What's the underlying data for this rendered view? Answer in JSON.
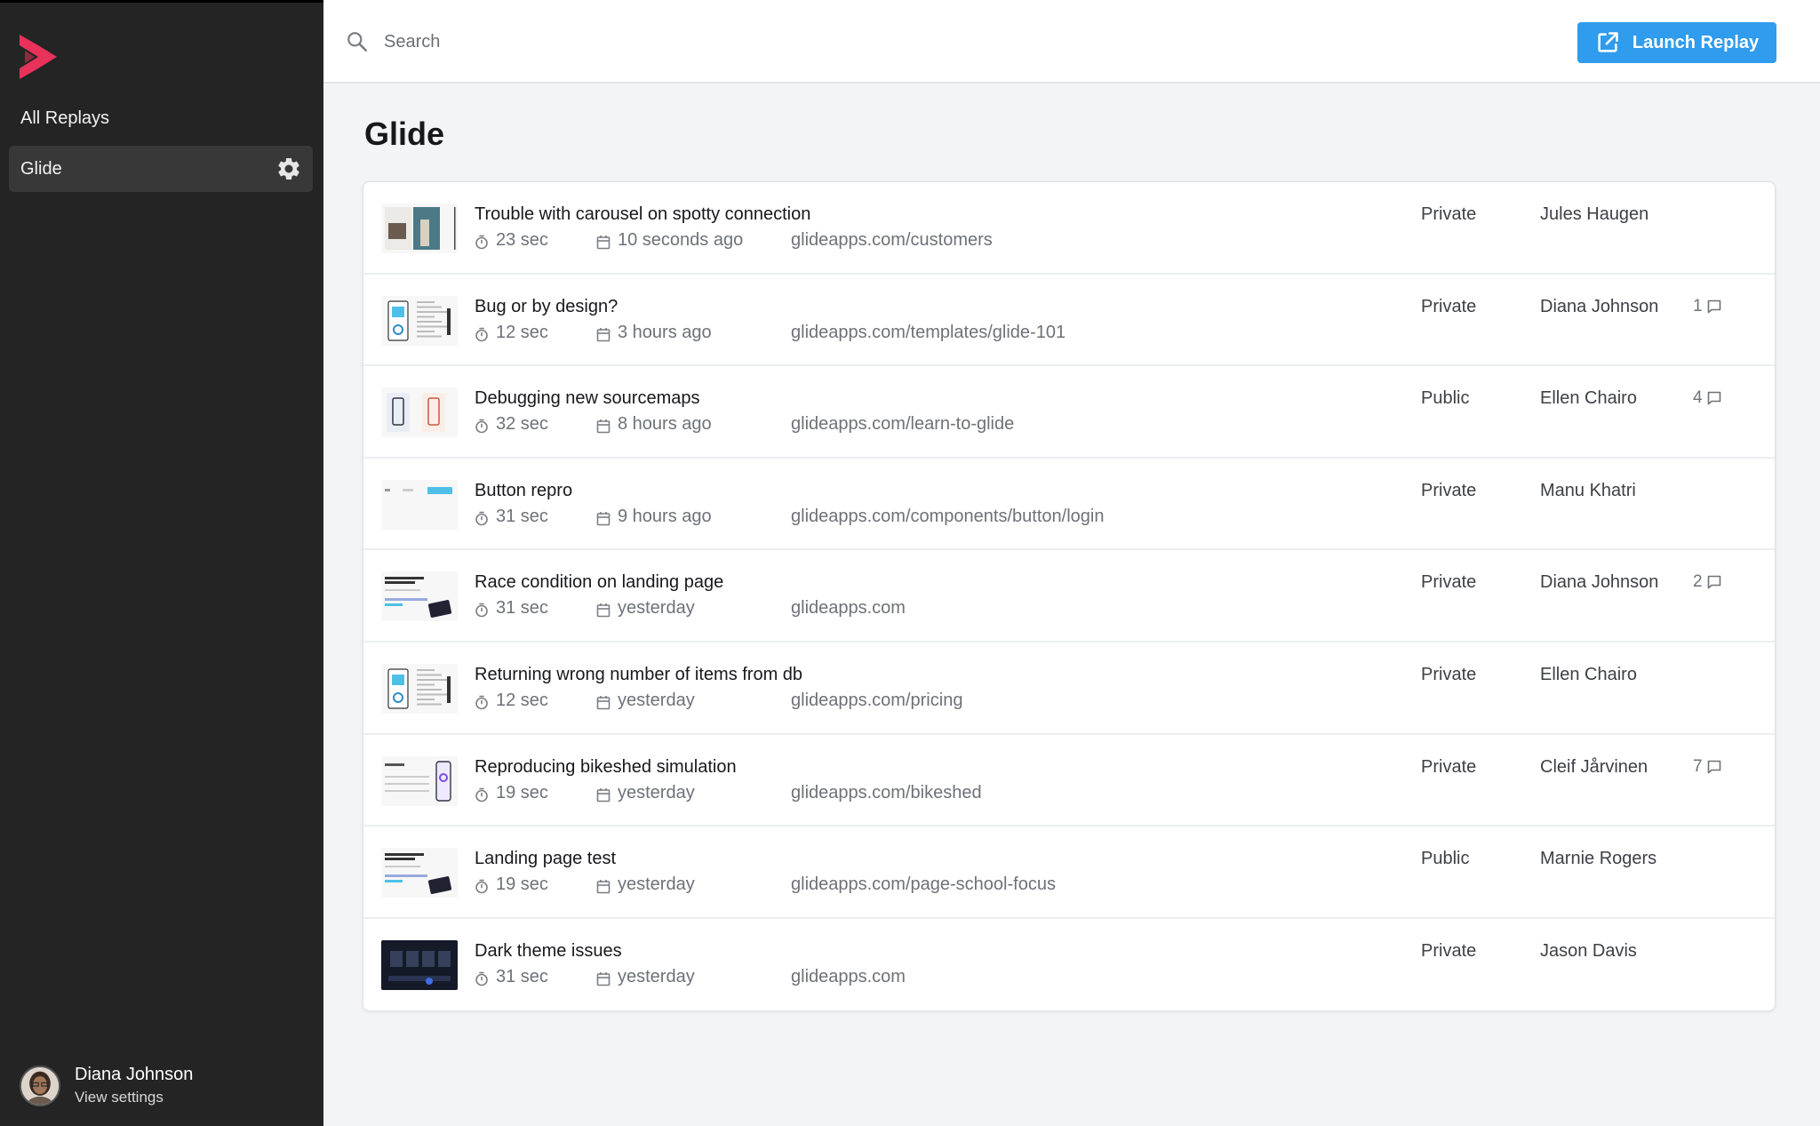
{
  "sidebar": {
    "nav": {
      "all_replays": "All Replays",
      "workspace": "Glide"
    },
    "user": {
      "name": "Diana Johnson",
      "sub": "View settings"
    }
  },
  "topbar": {
    "search_placeholder": "Search",
    "launch_label": "Launch Replay"
  },
  "main": {
    "title": "Glide",
    "replays": [
      {
        "title": "Trouble with carousel on spotty connection",
        "duration": "23 sec",
        "time": "10 seconds ago",
        "url": "glideapps.com/customers",
        "visibility": "Private",
        "author": "Jules Haugen",
        "comments": ""
      },
      {
        "title": "Bug or by design?",
        "duration": "12 sec",
        "time": "3 hours ago",
        "url": "glideapps.com/templates/glide-101",
        "visibility": "Private",
        "author": "Diana Johnson",
        "comments": "1"
      },
      {
        "title": "Debugging new sourcemaps",
        "duration": "32 sec",
        "time": "8 hours ago",
        "url": "glideapps.com/learn-to-glide",
        "visibility": "Public",
        "author": "Ellen Chairo",
        "comments": "4"
      },
      {
        "title": "Button repro",
        "duration": "31 sec",
        "time": "9 hours ago",
        "url": "glideapps.com/components/button/login",
        "visibility": "Private",
        "author": "Manu Khatri",
        "comments": ""
      },
      {
        "title": "Race condition on landing page",
        "duration": "31 sec",
        "time": "yesterday",
        "url": "glideapps.com",
        "visibility": "Private",
        "author": "Diana Johnson",
        "comments": "2"
      },
      {
        "title": "Returning wrong number of items from db",
        "duration": "12 sec",
        "time": "yesterday",
        "url": "glideapps.com/pricing",
        "visibility": "Private",
        "author": "Ellen Chairo",
        "comments": ""
      },
      {
        "title": "Reproducing bikeshed simulation",
        "duration": "19 sec",
        "time": "yesterday",
        "url": "glideapps.com/bikeshed",
        "visibility": "Private",
        "author": "Cleif Jårvinen",
        "comments": "7"
      },
      {
        "title": "Landing page test",
        "duration": "19 sec",
        "time": "yesterday",
        "url": "glideapps.com/page-school-focus",
        "visibility": "Public",
        "author": "Marnie Rogers",
        "comments": ""
      },
      {
        "title": "Dark theme issues",
        "duration": "31 sec",
        "time": "yesterday",
        "url": "glideapps.com",
        "visibility": "Private",
        "author": "Jason Davis",
        "comments": ""
      }
    ]
  },
  "colors": {
    "brand": "#e8325a",
    "accent": "#2f9ced",
    "sidebar_bg": "#242424",
    "page_bg": "#f3f4f6"
  },
  "icons": {
    "logo": "replay-logo-icon",
    "settings": "gear-icon",
    "search": "search-icon",
    "launch": "external-link-icon",
    "duration": "timer-icon",
    "date": "calendar-icon",
    "comments": "comment-icon"
  }
}
